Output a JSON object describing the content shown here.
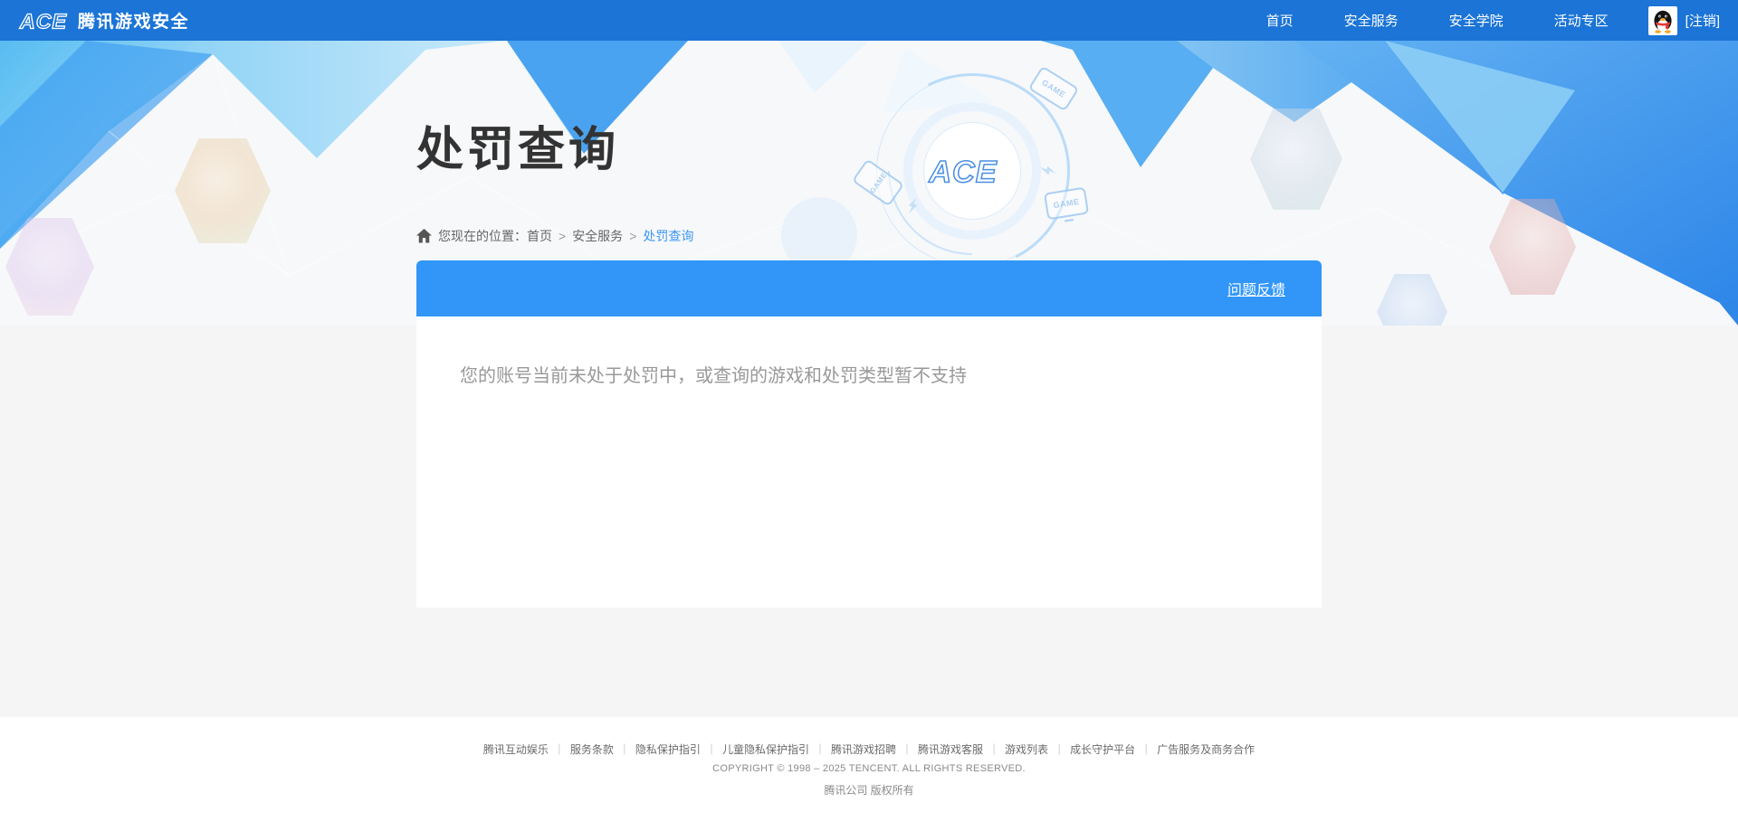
{
  "colors": {
    "header_bg": "#1B74D6",
    "bar_blue": "#3296F8",
    "link_blue": "#3B97F7",
    "banner_bg": "#F7F8FA",
    "page_bg": "#F5F5F6",
    "title_color": "#333333",
    "message_color": "#999999"
  },
  "header": {
    "logo_mark": "ACE",
    "logo_text": "腾讯游戏安全",
    "nav": [
      {
        "label": "首页"
      },
      {
        "label": "安全服务"
      },
      {
        "label": "安全学院"
      },
      {
        "label": "活动专区"
      }
    ],
    "avatar_icon": "qq-penguin-avatar",
    "logout_label": "[注销]"
  },
  "hero": {
    "title": "处罚查询",
    "breadcrumb": {
      "icon": "home-icon",
      "prefix": "您现在的位置：",
      "items": [
        {
          "label": "首页"
        },
        {
          "label": "安全服务"
        },
        {
          "label": "处罚查询"
        }
      ],
      "separator": ">"
    },
    "emblem_mark": "ACE",
    "game_chip_label": "GAME"
  },
  "result_card": {
    "feedback_link": "问题反馈",
    "message": "您的账号当前未处于处罚中，或查询的游戏和处罚类型暂不支持"
  },
  "footer": {
    "links": [
      "腾讯互动娱乐",
      "服务条款",
      "隐私保护指引",
      "儿童隐私保护指引",
      "腾讯游戏招聘",
      "腾讯游戏客服",
      "游戏列表",
      "成长守护平台",
      "广告服务及商务合作"
    ],
    "separator": "｜",
    "copyright": "COPYRIGHT © 1998 – 2025 TENCENT. ALL RIGHTS RESERVED.",
    "company": "腾讯公司 版权所有"
  }
}
